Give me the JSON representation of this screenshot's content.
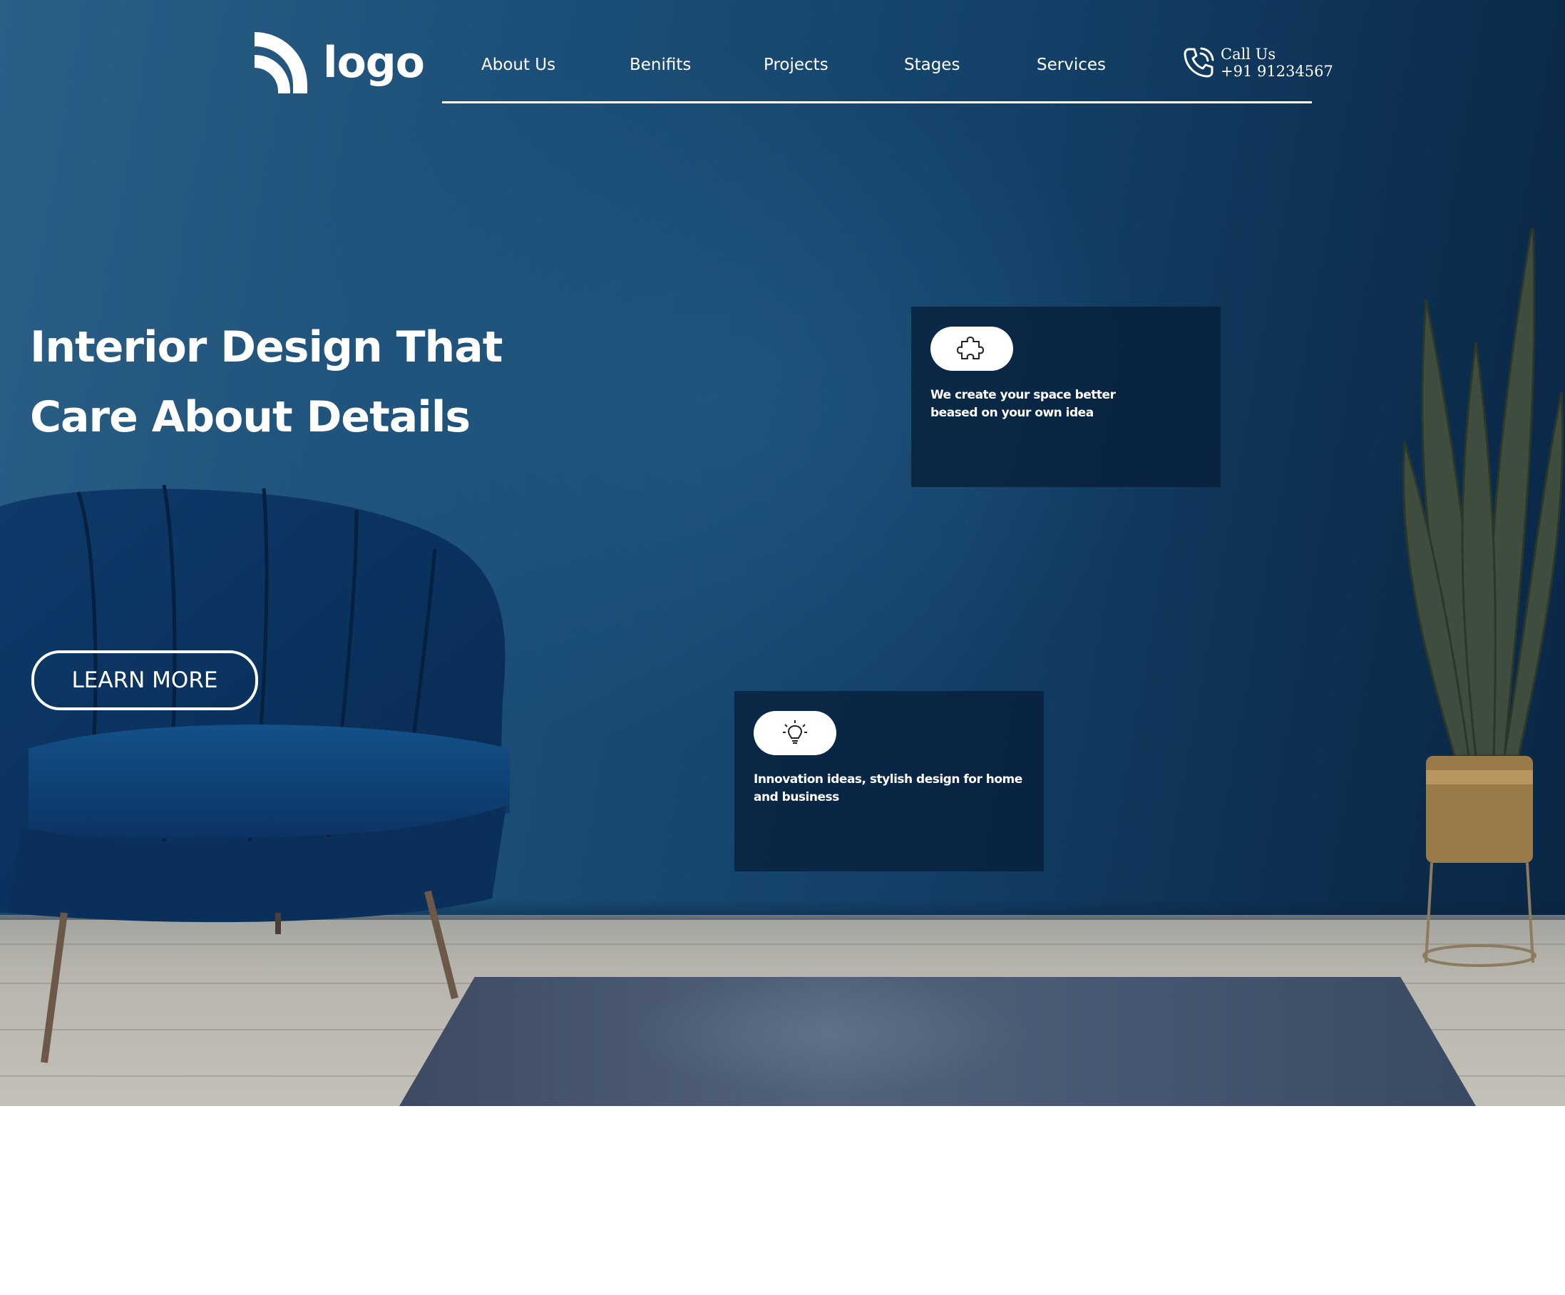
{
  "header": {
    "logo_text": "logo",
    "nav": [
      {
        "label": "About Us"
      },
      {
        "label": "Benifits"
      },
      {
        "label": "Projects"
      },
      {
        "label": "Stages"
      },
      {
        "label": "Services"
      }
    ],
    "call": {
      "label": "Call Us",
      "phone": "+91 91234567"
    }
  },
  "hero": {
    "headline_line1": "Interior Design That",
    "headline_line2": "Care About Details",
    "cta_label": "LEARN MORE"
  },
  "cards": [
    {
      "icon": "puzzle-icon",
      "text": "We create your space better beased on your own idea"
    },
    {
      "icon": "lightbulb-icon",
      "text": "Innovation ideas, stylish design for home and business"
    }
  ],
  "colors": {
    "wall_dark": "#0a2644",
    "wall_light": "#2b5f86",
    "card_bg": "#061c36",
    "text": "#ffffff"
  }
}
